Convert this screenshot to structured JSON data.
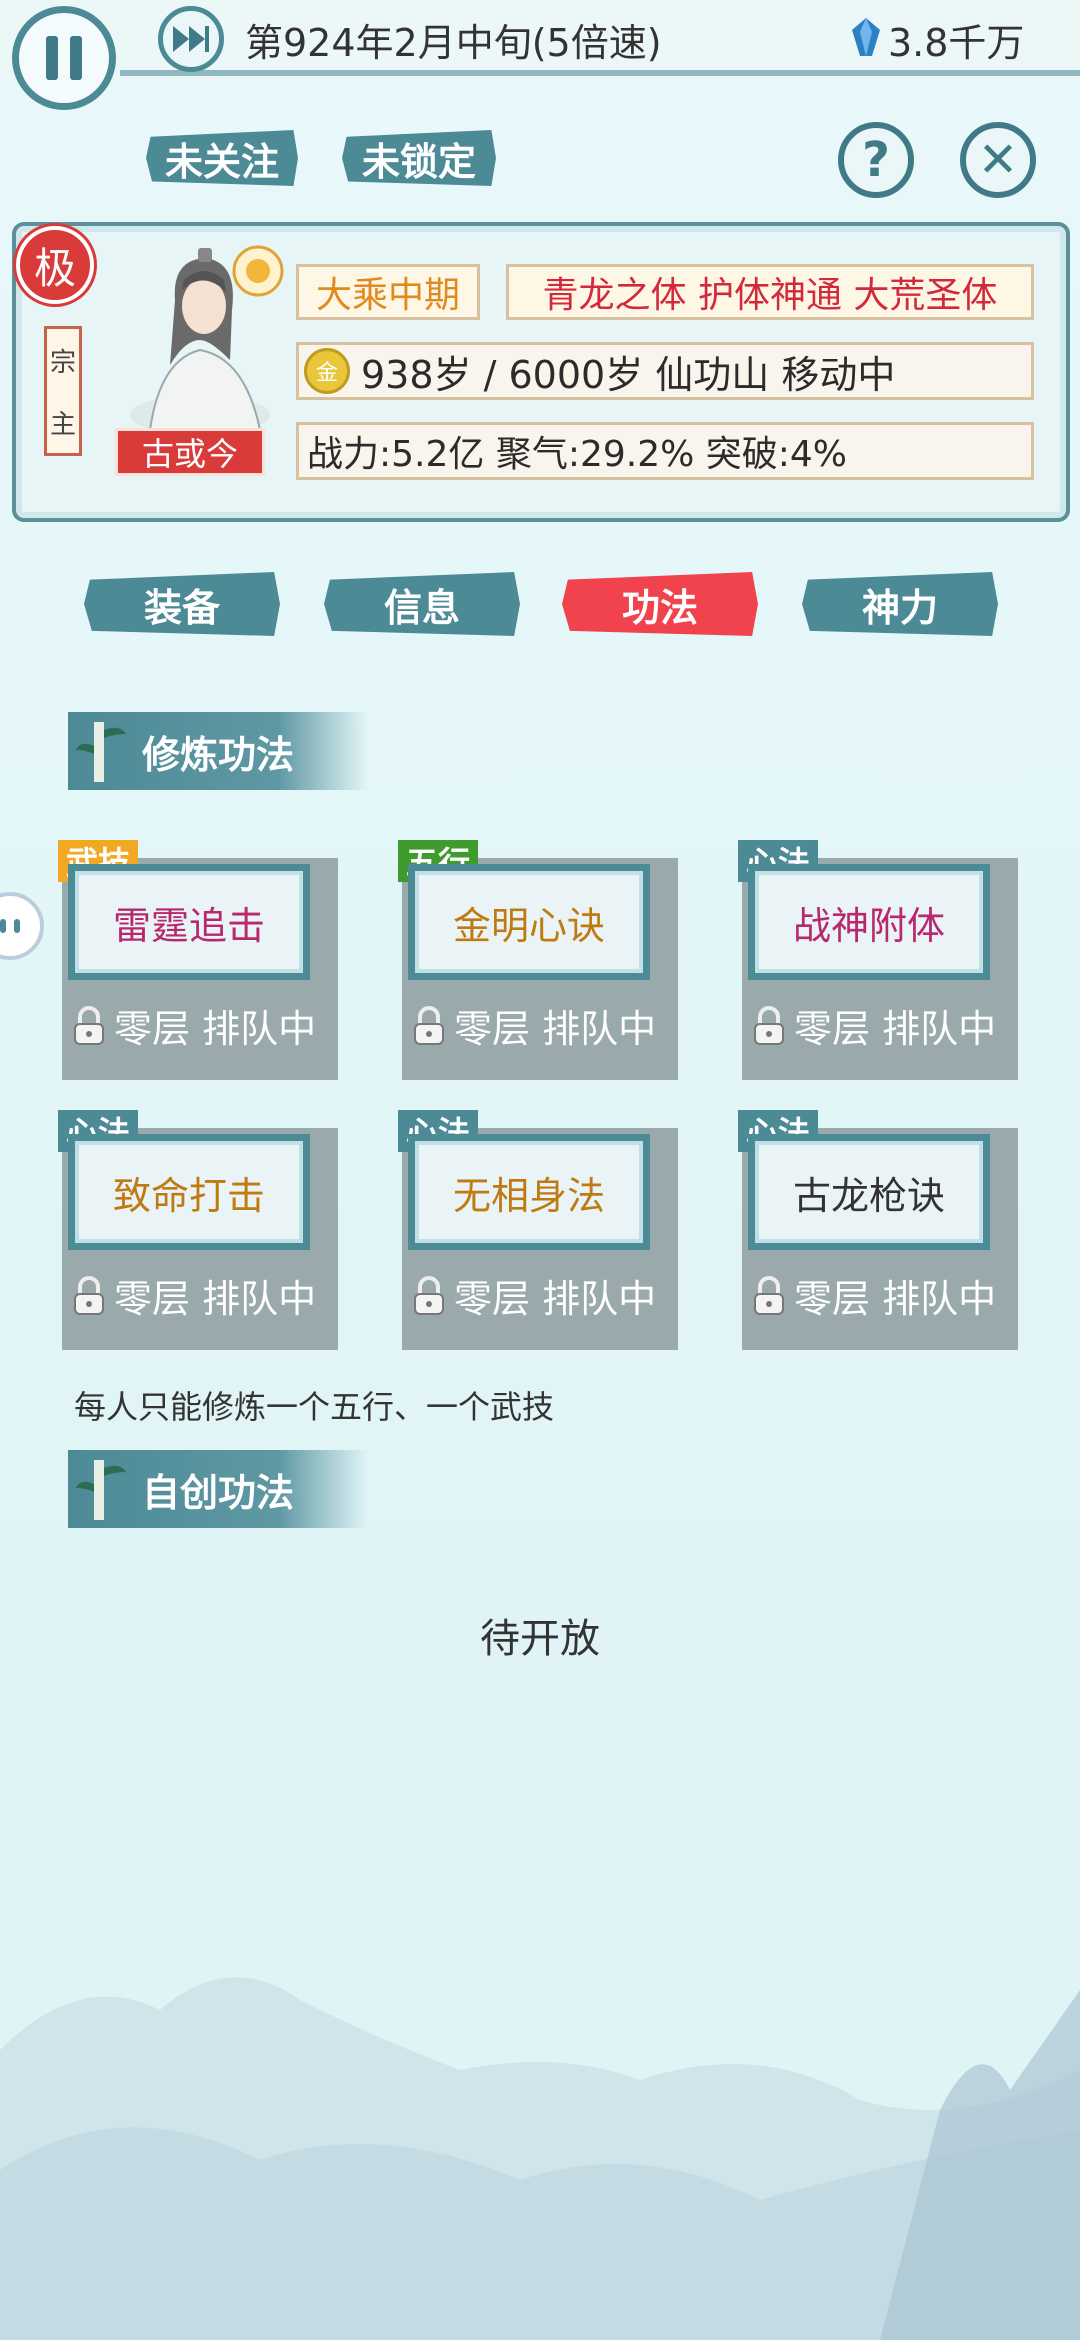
{
  "topbar": {
    "date": "第924年2月中旬(5倍速)",
    "money": "3.8千万"
  },
  "follow": {
    "unfollowed": "未关注",
    "unlocked": "未锁定"
  },
  "profile": {
    "grade_badge": "极",
    "sect_role": [
      "宗",
      "主"
    ],
    "name": "古或今",
    "realm": "大乘中期",
    "bodies": "青龙之体 护体神通 大荒圣体",
    "element_badge": "金",
    "age_location": "938岁 / 6000岁  仙功山  移动中",
    "stats": "战力:5.2亿 聚气:29.2% 突破:4%"
  },
  "tabs": [
    {
      "label": "装备"
    },
    {
      "label": "信息"
    },
    {
      "label": "功法"
    },
    {
      "label": "神力"
    }
  ],
  "sections": {
    "cultivation": "修炼功法",
    "custom": "自创功法"
  },
  "skills": [
    {
      "tag": "武技",
      "name": "雷霆追击",
      "status": "零层 排队中",
      "tag_color": "#f2a822",
      "name_color": "#b8286e"
    },
    {
      "tag": "五行",
      "name": "金明心诀",
      "status": "零层 排队中",
      "tag_color": "#3f9b2e",
      "name_color": "#c07a12"
    },
    {
      "tag": "心法",
      "name": "战神附体",
      "status": "零层 排队中",
      "tag_color": "#4c8a96",
      "name_color": "#b8286e"
    },
    {
      "tag": "心法",
      "name": "致命打击",
      "status": "零层 排队中",
      "tag_color": "#4c8a96",
      "name_color": "#c07a12"
    },
    {
      "tag": "心法",
      "name": "无相身法",
      "status": "零层 排队中",
      "tag_color": "#4c8a96",
      "name_color": "#c07a12"
    },
    {
      "tag": "心法",
      "name": "古龙枪诀",
      "status": "零层 排队中",
      "tag_color": "#4c8a96",
      "name_color": "#333333"
    }
  ],
  "note": "每人只能修炼一个五行、一个武技",
  "pending": "待开放",
  "colors": {
    "accent": "#4c8a96",
    "active_tab": "#f0434d",
    "badge_red": "#d93a3a"
  }
}
